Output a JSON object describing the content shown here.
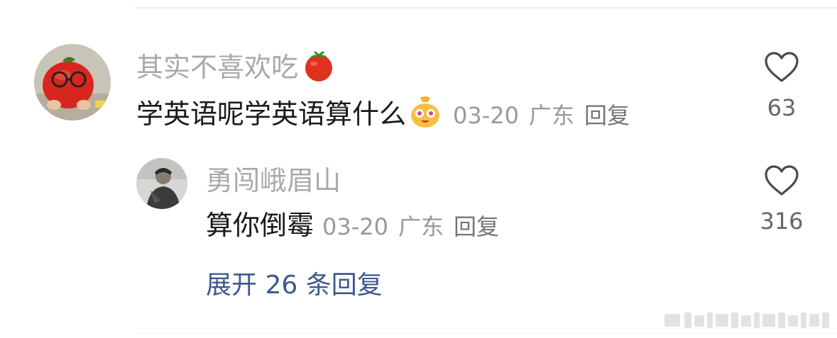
{
  "comments": [
    {
      "username": "其实不喜欢吃",
      "username_icon": "tomato-icon",
      "text": "学英语呢学英语算什么",
      "text_emoji": "money-bag-face-emoji",
      "date": "03-20",
      "location": "广东",
      "reply_label": "回复",
      "likes": "63",
      "avatar": "tomato-plush-avatar"
    },
    {
      "username": "勇闯峨眉山",
      "text": "算你倒霉",
      "date": "03-20",
      "location": "广东",
      "reply_label": "回复",
      "likes": "316",
      "avatar": "person-photo-avatar"
    }
  ],
  "expand_replies": "展开 26 条回复",
  "icons": {
    "like": "heart-outline-icon"
  },
  "colors": {
    "username": "#a9a9a9",
    "text": "#1a1a1a",
    "meta": "#999999",
    "link": "#3d5a8f"
  }
}
